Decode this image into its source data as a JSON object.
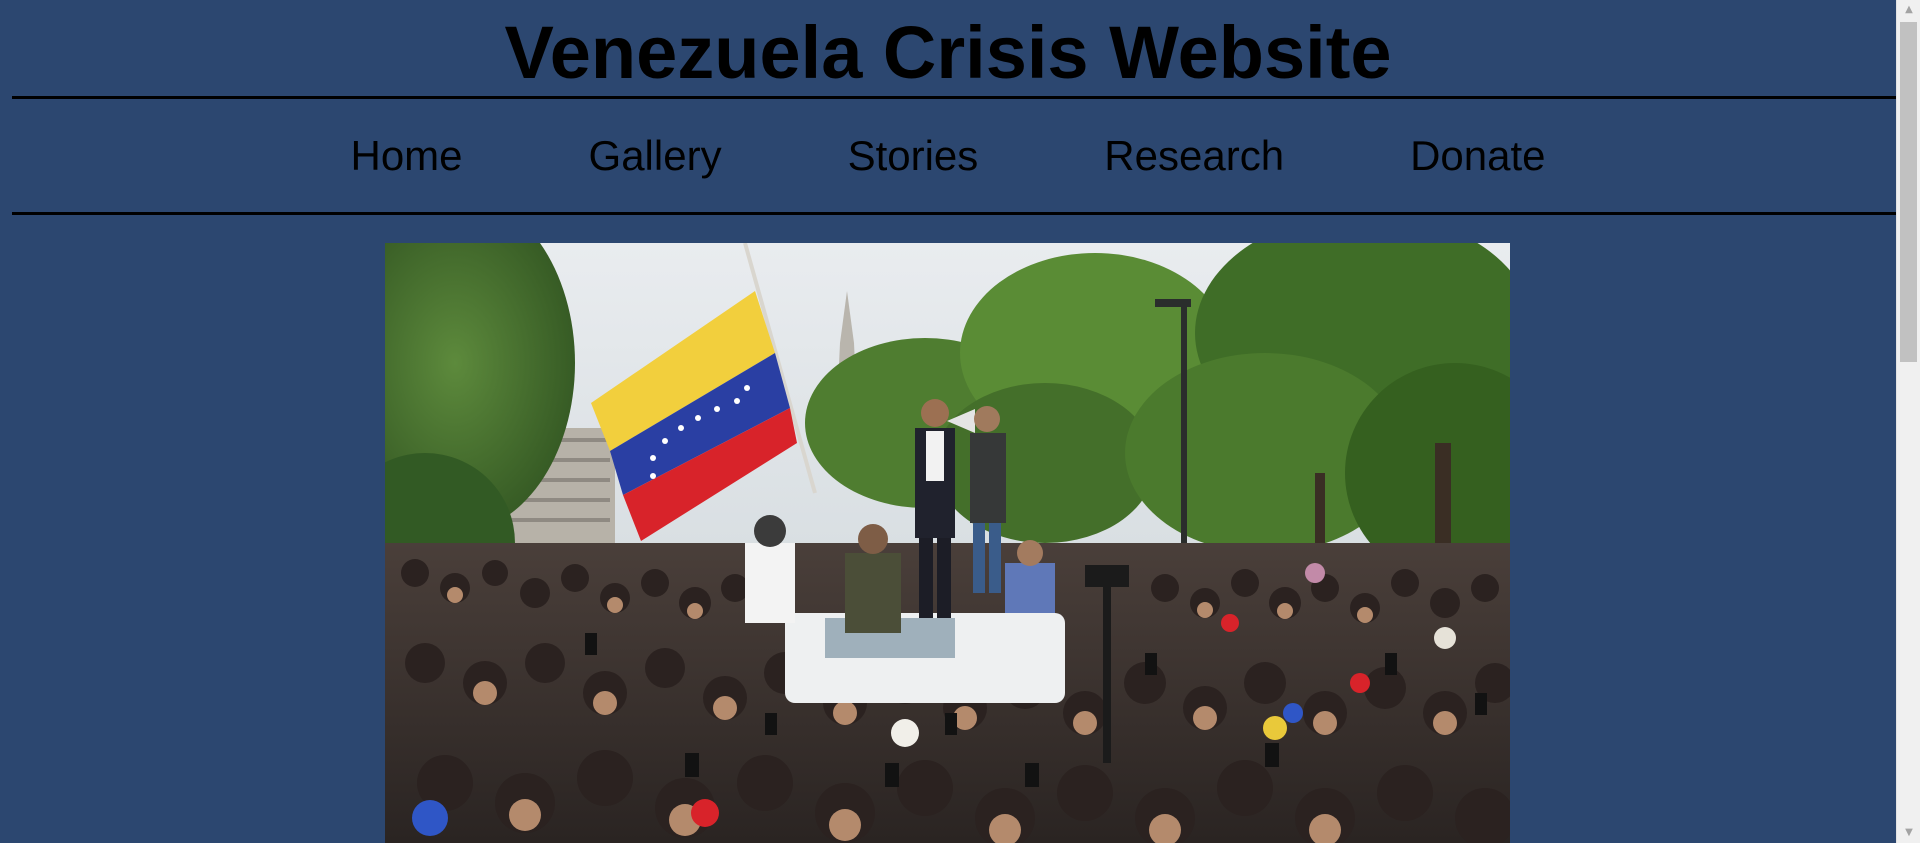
{
  "header": {
    "title": "Venezuela Crisis Website"
  },
  "nav": {
    "items": [
      {
        "label": "Home"
      },
      {
        "label": "Gallery"
      },
      {
        "label": "Stories"
      },
      {
        "label": "Research"
      },
      {
        "label": "Donate"
      }
    ]
  },
  "hero": {
    "subject": "crowd rally with Venezuelan flag"
  },
  "colors": {
    "page_background": "#2c4770",
    "rule": "#000000",
    "text": "#000000"
  },
  "icons": {
    "scroll_up": "scroll-up-arrow-icon",
    "scroll_down": "scroll-down-arrow-icon"
  }
}
